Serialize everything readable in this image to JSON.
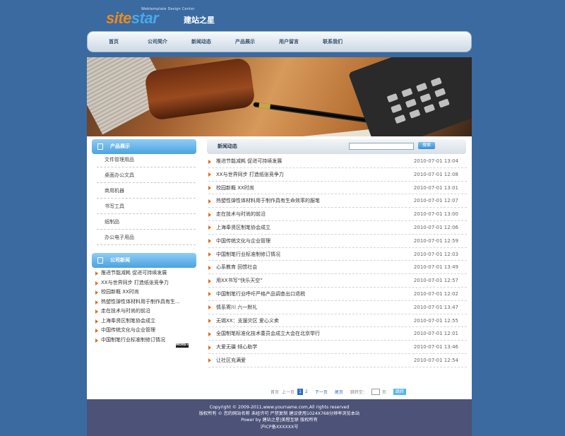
{
  "logo": {
    "word1": "site",
    "word2": "star",
    "tagline": "Webtemplate Design Center",
    "cn_name": "建站之星"
  },
  "nav": [
    "首页",
    "公司简介",
    "新闻动态",
    "产品展示",
    "用户留言",
    "联系我们"
  ],
  "sidebar": {
    "products": {
      "title": "产品展示",
      "items": [
        "文件管理用品",
        "桌面办公文具",
        "商用机器",
        "书写工具",
        "纸制品",
        "办公电子用品"
      ]
    },
    "company_news": {
      "title": "公司新闻",
      "items": [
        "推进节能减耗 促进可持续发展",
        "XX与世界同步 打造纸张竞争力",
        "校园新概 XX时尚",
        "热塑性弹性体材料用于制作具有生...",
        "走在技术与时尚的前沿",
        "上海奉贤区制笔协会成立",
        "中国传统文化与企业管理",
        "中国制笔行业标准制修订情况"
      ],
      "more_label": "MORE+"
    }
  },
  "main": {
    "title": "新闻动态",
    "search_button": "搜索",
    "news": [
      {
        "title": "推进节能减耗 促进可持续发展",
        "date": "2010-07-01 13:04"
      },
      {
        "title": "XX与世界同步 打造纸张竞争力",
        "date": "2010-07-01 12:08"
      },
      {
        "title": "校园新概 XX时尚",
        "date": "2010-07-01 13:01"
      },
      {
        "title": "热塑性弹性体材料用于制作具有生命效率的服笔",
        "date": "2010-07-01 12:07"
      },
      {
        "title": "走在技术与时尚的前沿",
        "date": "2010-07-01 13:00"
      },
      {
        "title": "上海奉贤区制笔协会成立",
        "date": "2010-07-01 12:06"
      },
      {
        "title": "中国传统文化与企业管理",
        "date": "2010-07-01 12:59"
      },
      {
        "title": "中国制笔行业标准制修订情况",
        "date": "2010-07-01 12:03"
      },
      {
        "title": "心系教育 回馈社会",
        "date": "2010-07-01 13:49"
      },
      {
        "title": "用XX书写“快乐天空”",
        "date": "2010-07-01 12:57"
      },
      {
        "title": "中国制笔行业呼吁严格产品调查出口退税",
        "date": "2010-07-01 12:02"
      },
      {
        "title": "情系寄川 六一默礼",
        "date": "2010-07-01 13:47"
      },
      {
        "title": "无锡XX：支援灾区 爱心义卖",
        "date": "2010-07-01 12:55"
      },
      {
        "title": "全国制笔标准化技术委员会成立大会在北京举行",
        "date": "2010-07-01 12:01"
      },
      {
        "title": "大爱无疆 倾心助学",
        "date": "2010-07-01 13:46"
      },
      {
        "title": "让社区充满爱",
        "date": "2010-07-01 12:54"
      }
    ]
  },
  "pager": {
    "first": "首页",
    "prev": "上一页",
    "current": "1",
    "page2": "2",
    "next": "下一页",
    "last": "尾页",
    "jump_label": "跳转至：",
    "page_unit": "页",
    "go": "跳转"
  },
  "footer": {
    "line1": "Copyright © 2009-2011,www.yourname.com,All rights reserved",
    "line2": "版权所有 © 您的网站名称  未经许可  严禁复制  建议使用1024X768分辨率浏览本站",
    "line3": "Power by 建站之星|美橙互联 版权所有",
    "line4": "沪ICP备XXXXXX号"
  }
}
